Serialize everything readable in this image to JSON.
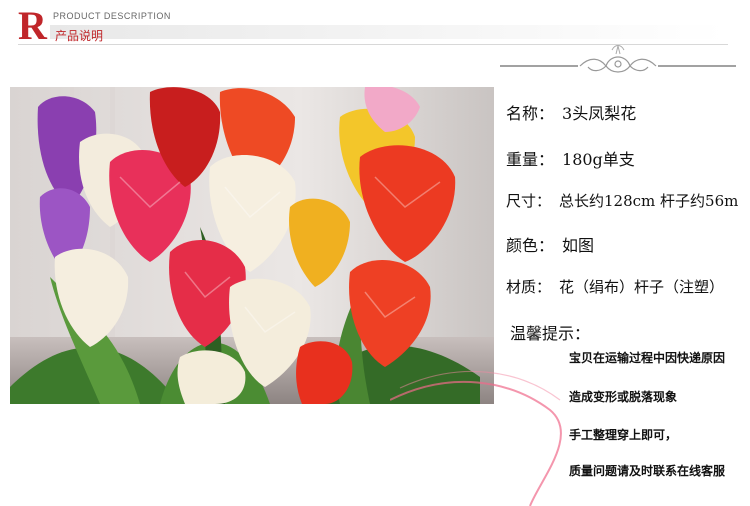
{
  "header": {
    "logo_letter": "R",
    "title_en": "PRODUCT DESCRIPTION",
    "title_cn": "产品说明"
  },
  "specs": [
    {
      "label": "名称：",
      "value": "3头凤梨花"
    },
    {
      "label": "重量：",
      "value": "180g单支"
    },
    {
      "label": "尺寸：",
      "value": "总长约128cm 杆子约56m"
    },
    {
      "label": "颜色：",
      "value": "如图"
    },
    {
      "label": "材质：",
      "value": "花（绢布）杆子（注塑）"
    }
  ],
  "tips": {
    "title": "温馨提示：",
    "items": [
      "宝贝在运输过程中因快递原因",
      "造成变形或脱落现象",
      "手工整理穿上即可，",
      "质量问题请及时联系在线客服"
    ]
  },
  "colors": {
    "brand_red": "#c0262a",
    "ribbon_pink": "#f06a8a"
  }
}
